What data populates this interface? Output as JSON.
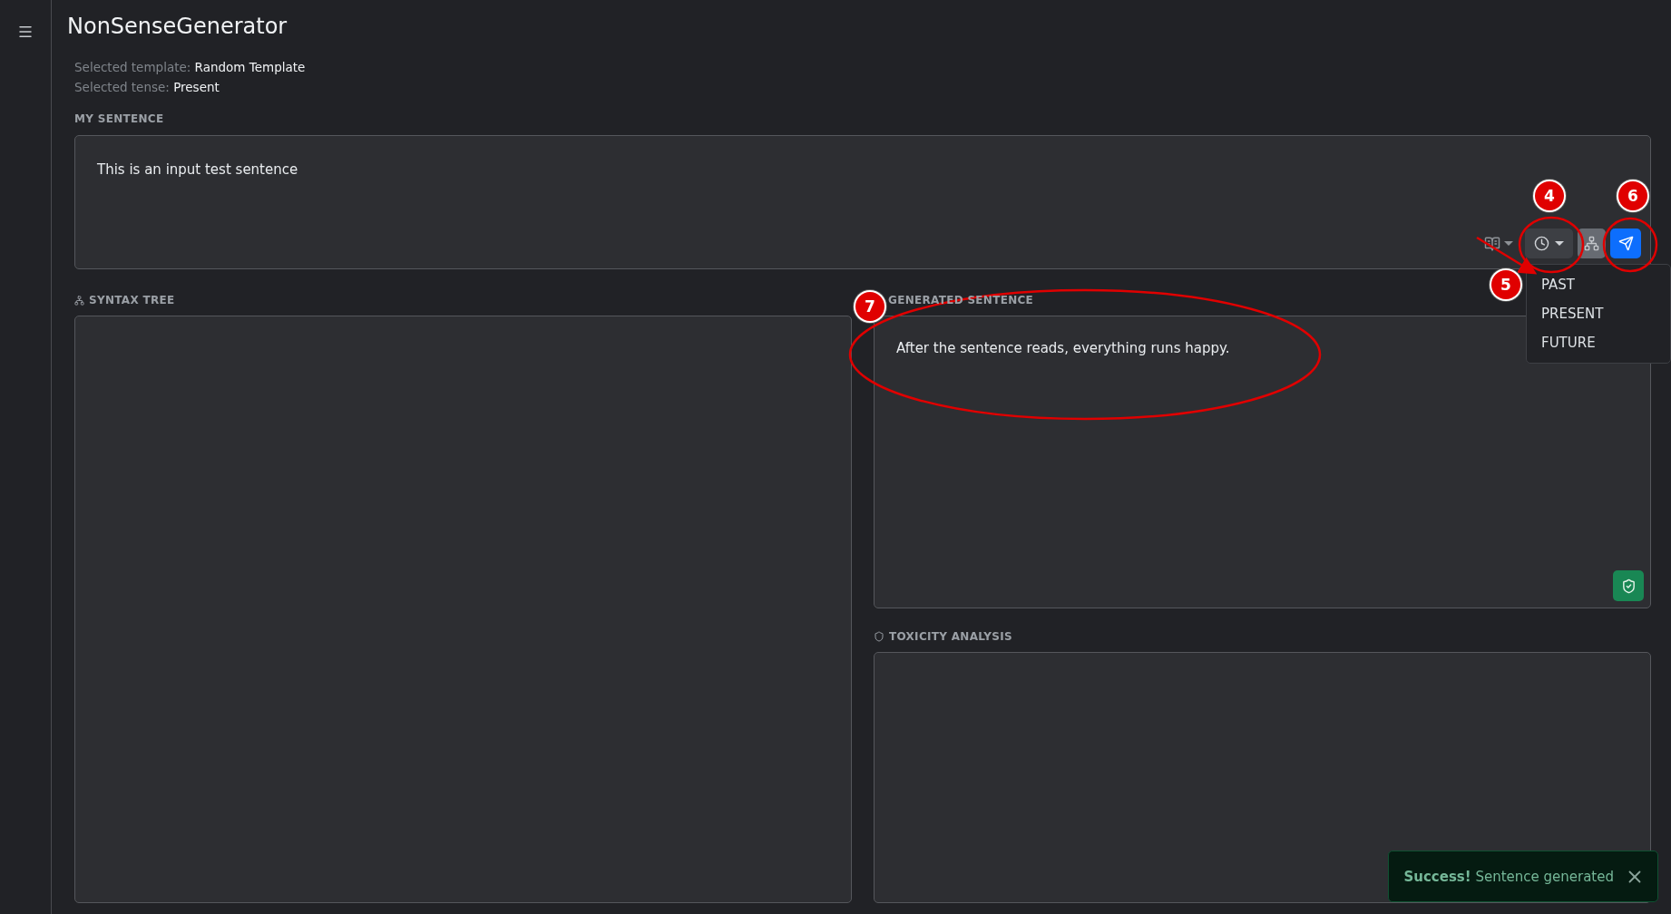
{
  "app": {
    "title": "NonSenseGenerator"
  },
  "info": [
    {
      "label": "Selected template:",
      "value": "Random Template"
    },
    {
      "label": "Selected tense:",
      "value": "Present"
    }
  ],
  "my_sentence": {
    "label": "MY SENTENCE",
    "value": "This is an input test sentence"
  },
  "tense_menu": {
    "open": true,
    "items": [
      {
        "label": "PAST"
      },
      {
        "label": "PRESENT"
      },
      {
        "label": "FUTURE"
      }
    ]
  },
  "syntax_tree": {
    "label": "SYNTAX TREE"
  },
  "generated": {
    "label": "GENERATED SENTENCE",
    "value": "After the sentence reads, everything runs happy."
  },
  "toxicity": {
    "label": "TOXICITY ANALYSIS"
  },
  "toast": {
    "text": "**Success!** Sentence generated"
  },
  "annotations": [
    {
      "label": "4"
    },
    {
      "label": "6"
    },
    {
      "label": "5"
    },
    {
      "label": "7"
    }
  ]
}
